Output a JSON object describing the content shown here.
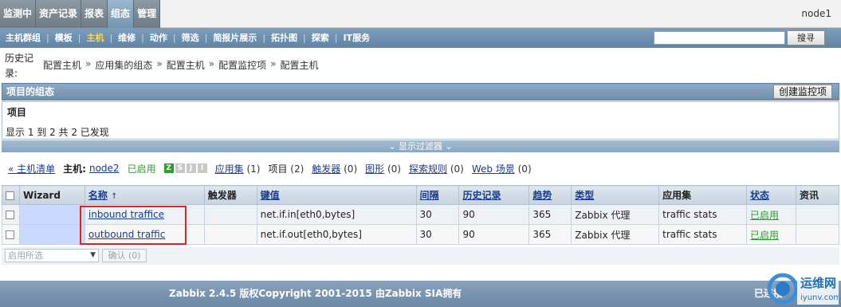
{
  "top_tabs": [
    {
      "label": "监测中",
      "active": false
    },
    {
      "label": "资产记录",
      "active": false
    },
    {
      "label": "报表",
      "active": false
    },
    {
      "label": "组态",
      "active": true
    },
    {
      "label": "管理",
      "active": false
    }
  ],
  "node_name": "node1",
  "submenu": [
    {
      "label": "主机群组",
      "active": false
    },
    {
      "label": "模板",
      "active": false
    },
    {
      "label": "主机",
      "active": true
    },
    {
      "label": "维修",
      "active": false
    },
    {
      "label": "动作",
      "active": false
    },
    {
      "label": "筛选",
      "active": false
    },
    {
      "label": "简报片展示",
      "active": false
    },
    {
      "label": "拓扑图",
      "active": false
    },
    {
      "label": "探索",
      "active": false
    },
    {
      "label": "IT服务",
      "active": false
    }
  ],
  "search": {
    "value": "",
    "button_label": "搜寻"
  },
  "history": {
    "label": "历史记录:",
    "crumbs": [
      "配置主机",
      "应用集的组态",
      "配置主机",
      "配置监控项",
      "配置主机"
    ],
    "separator": "»"
  },
  "config": {
    "title": "项目的组态",
    "create_button": "创建监控项"
  },
  "items_box": {
    "title": "项目",
    "count_text": "显示 1 到 2 共 2 已发现"
  },
  "filter_toggle": "⌄ 显示过滤器 ⌄",
  "host_info": {
    "back_link": "« 主机清单",
    "host_label": "主机:",
    "host_name": "node2",
    "enabled_text": "已启用",
    "zbx_icons": [
      "Z",
      "S",
      "J",
      "I"
    ],
    "tabs": [
      {
        "label": "应用集",
        "count": "(1)",
        "link": true
      },
      {
        "label": "项目",
        "count": "(2)",
        "link": false
      },
      {
        "label": "触发器",
        "count": "(0)",
        "link": true
      },
      {
        "label": "图形",
        "count": "(0)",
        "link": true
      },
      {
        "label": "探索规则",
        "count": "(0)",
        "link": true
      },
      {
        "label": "Web 场景",
        "count": "(0)",
        "link": true
      }
    ]
  },
  "table": {
    "headers": {
      "wizard": "Wizard",
      "name": "名称",
      "name_sort": "↑",
      "triggers": "触发器",
      "key": "键值",
      "interval": "间隔",
      "history": "历史记录",
      "trends": "趋势",
      "type": "类型",
      "applications": "应用集",
      "status": "状态",
      "info": "资讯"
    },
    "rows": [
      {
        "name": "inbound traffice",
        "triggers": "",
        "key": "net.if.in[eth0,bytes]",
        "interval": "30",
        "history": "90",
        "trends": "365",
        "type": "Zabbix 代理",
        "applications": "traffic stats",
        "status": "已启用",
        "info": ""
      },
      {
        "name": "outbound traffic",
        "triggers": "",
        "key": "net.if.out[eth0,bytes]",
        "interval": "30",
        "history": "90",
        "trends": "365",
        "type": "Zabbix 代理",
        "applications": "traffic stats",
        "status": "已启用",
        "info": ""
      }
    ]
  },
  "actions": {
    "select_value": "启用所选",
    "confirm_button": "确认 (0)"
  },
  "footer": {
    "copyright": "Zabbix 2.4.5 版权Copyright 2001-2015 由Zabbix SIA拥有",
    "right_text": "已连接"
  },
  "watermark": {
    "text": "运维网",
    "url_text": "iyunv.com"
  },
  "colors": {
    "accent": "#6f8fae",
    "enabled": "#2ca02c",
    "highlight": "#dd2222"
  }
}
